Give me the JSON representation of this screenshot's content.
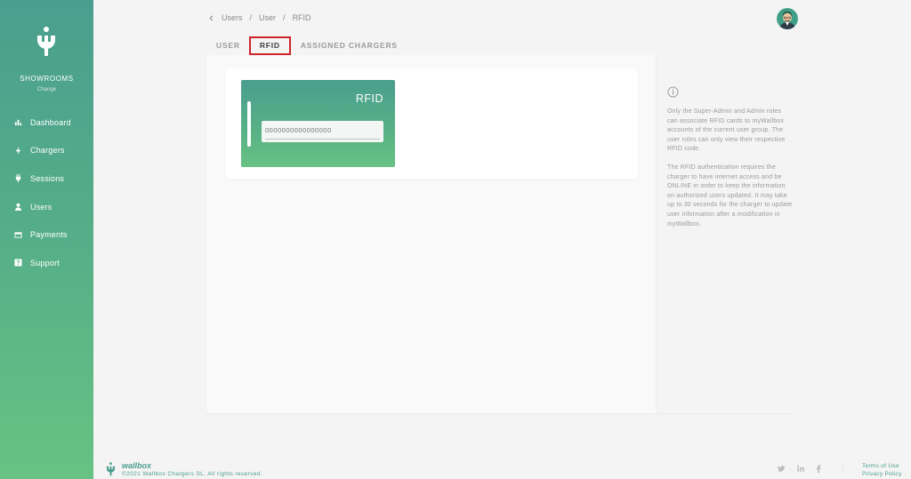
{
  "sidebar": {
    "group_name": "SHOWROOMS",
    "group_change": "Change",
    "items": [
      {
        "label": "Dashboard",
        "icon": "bar-chart-icon"
      },
      {
        "label": "Chargers",
        "icon": "lightning-icon"
      },
      {
        "label": "Sessions",
        "icon": "plug-icon"
      },
      {
        "label": "Users",
        "icon": "user-icon"
      },
      {
        "label": "Payments",
        "icon": "credit-card-icon"
      },
      {
        "label": "Support",
        "icon": "help-icon"
      }
    ],
    "colors": {
      "top": "#4a9e8e",
      "bottom": "#68c283"
    }
  },
  "breadcrumb": {
    "items": [
      "Users",
      "User",
      "RFID"
    ],
    "separator": "/"
  },
  "tabs": [
    {
      "label": "USER",
      "selected": false
    },
    {
      "label": "RFID",
      "selected": true
    },
    {
      "label": "ASSIGNED CHARGERS",
      "selected": false
    }
  ],
  "rfid_card": {
    "title": "RFID",
    "code_placeholder": "0000000000000000"
  },
  "info": {
    "paragraph1": "Only the Super-Admin and Admin roles can associate RFID cards to myWallbox accounts of the current user group. The user roles can only view their respective RFID code.",
    "paragraph2": "The RFID authentication requires the charger to have internet access and be ONLINE in order to keep the information on authorized users updated. It may take up to 30 seconds for the charger to update user information after a modification in myWallbox."
  },
  "footer": {
    "brand": "wallbox",
    "copyright": "©2021 Wallbox Chargers SL. All rights reserved.",
    "social": [
      "twitter-icon",
      "linkedin-icon",
      "facebook-icon"
    ],
    "links": [
      "Terms of Use",
      "Privacy Policy"
    ]
  }
}
